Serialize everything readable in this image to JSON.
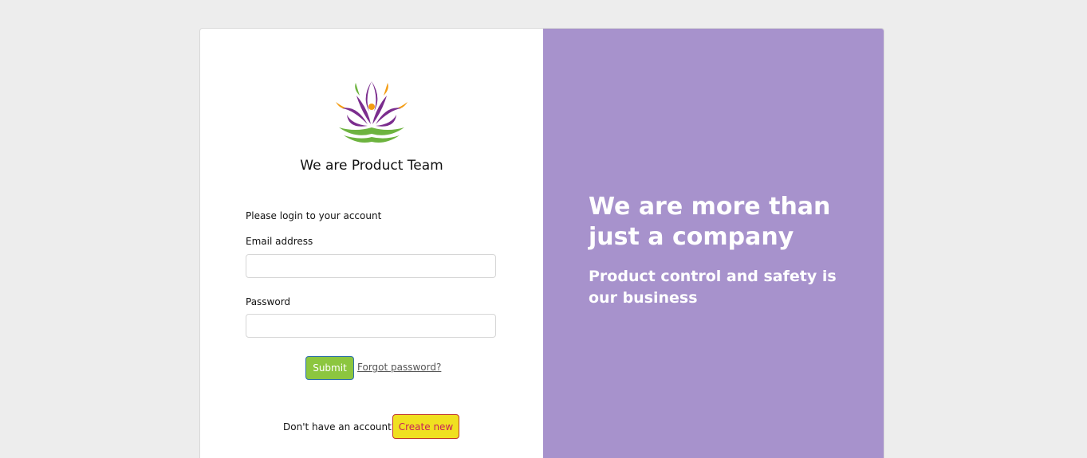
{
  "colors": {
    "page_bg": "#ededed",
    "panel_purple": "#a792cc",
    "submit_green": "#8cc63f",
    "create_yellow": "#f0e020"
  },
  "brand": {
    "logo_icon": "lotus-logo-icon",
    "team_title": "We are Product Team"
  },
  "login": {
    "prompt": "Please login to your account",
    "email_label": "Email address",
    "email_value": "",
    "password_label": "Password",
    "password_value": "",
    "submit_label": "Submit",
    "forgot_label": "Forgot password?",
    "no_account_text": "Don't have an account?",
    "create_label": "Create new"
  },
  "promo": {
    "headline": "We are more than just a company",
    "subline": "Product control and safety is our business"
  }
}
